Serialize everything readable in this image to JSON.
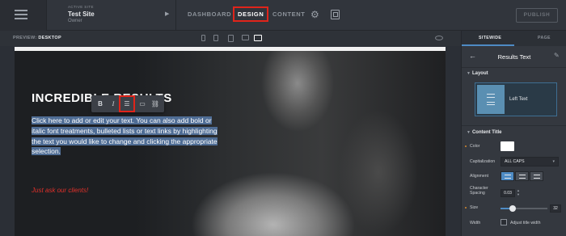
{
  "topbar": {
    "site_caption": "ACTIVE SITE",
    "site_name": "Test Site",
    "site_role": "Owner",
    "nav": [
      "DASHBOARD",
      "DESIGN",
      "CONTENT"
    ],
    "publish_label": "PUBLISH"
  },
  "preview": {
    "label": "PREVIEW:",
    "device": "DESKTOP"
  },
  "canvas": {
    "hero_title": "INCREDIBLE RESULTS",
    "body_text": "Click here to add or edit your text. You can also add bold or italic font treatments, bulleted lists or text links by highlighting the text you would like to change and clicking the appropriate selection.",
    "tagline": "Just ask our clients!",
    "toolbar": {
      "bold": "B",
      "italic": "I",
      "list": "☰",
      "image": "▭",
      "link": "⛓"
    }
  },
  "sidebar": {
    "tabs": [
      "SITEWIDE",
      "PAGE"
    ],
    "title": "Results Text",
    "layout_section": "Layout",
    "layout_choice": "Left Text",
    "content_title_section": "Content Title",
    "color_label": "Color",
    "capitalization_label": "Capitalization",
    "capitalization_value": "ALL CAPS",
    "alignment_label": "Alignment",
    "spacing_label": "Character Spacing",
    "spacing_value": "0.03",
    "size_label": "Size",
    "size_value": "32",
    "size_fraction": 0.25,
    "width_label": "Width",
    "adjust_label": "Adjust title width"
  },
  "colors": {
    "accent": "#4e8bc4",
    "highlight_box": "#e0241a",
    "tagline": "#e0302a"
  }
}
